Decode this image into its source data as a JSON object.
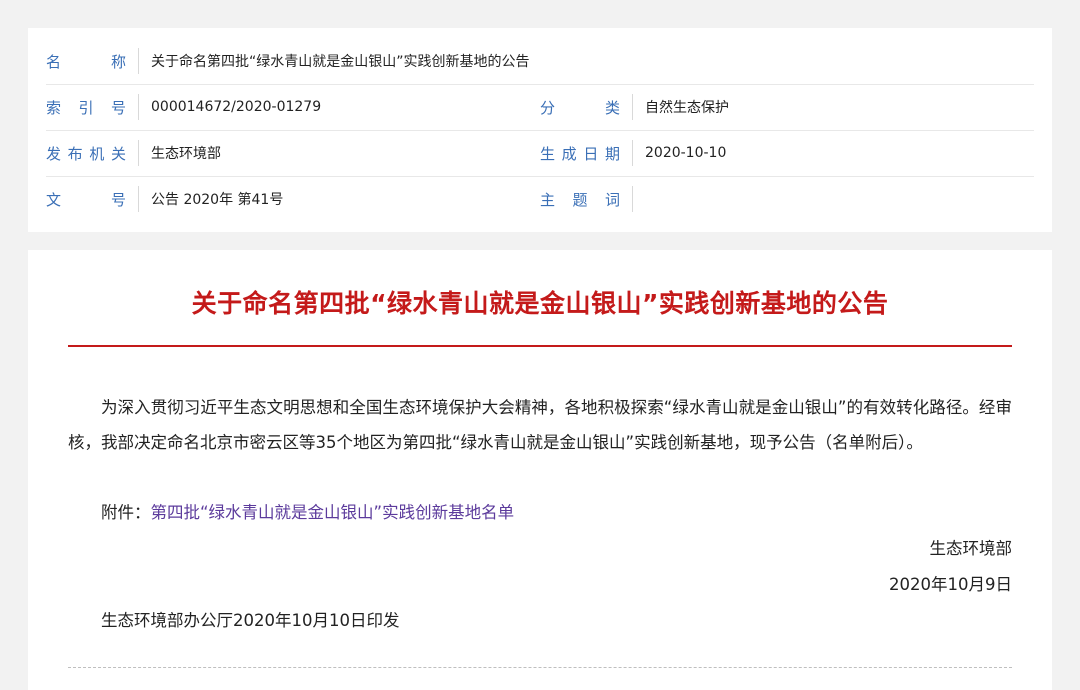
{
  "meta": {
    "name_label": [
      "名",
      "称"
    ],
    "name_value": "关于命名第四批“绿水青山就是金山银山”实践创新基地的公告",
    "index_label": [
      "索",
      "引",
      "号"
    ],
    "index_value": "000014672/2020-01279",
    "category_label": [
      "分",
      "类"
    ],
    "category_value": "自然生态保护",
    "issuer_label": [
      "发",
      "布",
      "机",
      "关"
    ],
    "issuer_value": "生态环境部",
    "date_label": [
      "生",
      "成",
      "日",
      "期"
    ],
    "date_value": "2020-10-10",
    "docno_label": [
      "文",
      "号"
    ],
    "docno_value": "公告 2020年 第41号",
    "subject_label": [
      "主",
      "题",
      "词"
    ],
    "subject_value": ""
  },
  "article": {
    "title": "关于命名第四批“绿水青山就是金山银山”实践创新基地的公告",
    "body": "为深入贯彻习近平生态文明思想和全国生态环境保护大会精神，各地积极探索“绿水青山就是金山银山”的有效转化路径。经审核，我部决定命名北京市密云区等35个地区为第四批“绿水青山就是金山银山”实践创新基地，现予公告（名单附后）。",
    "attachment_prefix": "附件：",
    "attachment_link": "第四批“绿水青山就是金山银山”实践创新基地名单",
    "signature": "生态环境部",
    "sign_date": "2020年10月9日",
    "issued_by": "生态环境部办公厅2020年10月10日印发"
  }
}
